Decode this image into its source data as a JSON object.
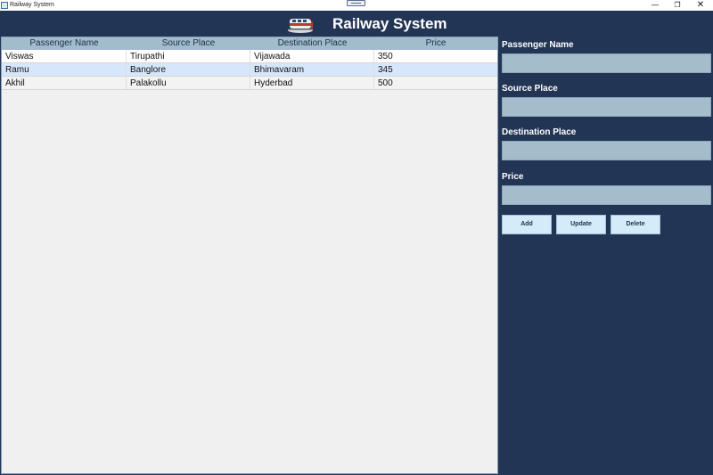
{
  "window": {
    "title": "Railway System",
    "controls": {
      "minimize": "—",
      "maximize": "❐",
      "close": "✕"
    }
  },
  "header": {
    "title": "Railway System",
    "icon": "train-icon"
  },
  "table": {
    "columns": [
      "Passenger Name",
      "Source Place",
      "Destination Place",
      "Price"
    ],
    "rows": [
      [
        "Viswas",
        "Tirupathi",
        "Vijawada",
        "350"
      ],
      [
        "Ramu",
        "Banglore",
        "Bhimavaram",
        "345"
      ],
      [
        "Akhil",
        "Palakollu",
        "Hyderbad",
        "500"
      ]
    ],
    "selected_row": 1
  },
  "form": {
    "fields": [
      {
        "label": "Passenger Name",
        "value": ""
      },
      {
        "label": "Source Place",
        "value": ""
      },
      {
        "label": "Destination Place",
        "value": ""
      },
      {
        "label": "Price",
        "value": ""
      }
    ],
    "buttons": {
      "add": "Add",
      "update": "Update",
      "delete": "Delete"
    }
  },
  "colors": {
    "background": "#233555",
    "header_row": "#a3bccb",
    "input_fill": "#a5bccb",
    "button_fill": "#d6ebf9",
    "selected_row": "#d6e7fb"
  }
}
